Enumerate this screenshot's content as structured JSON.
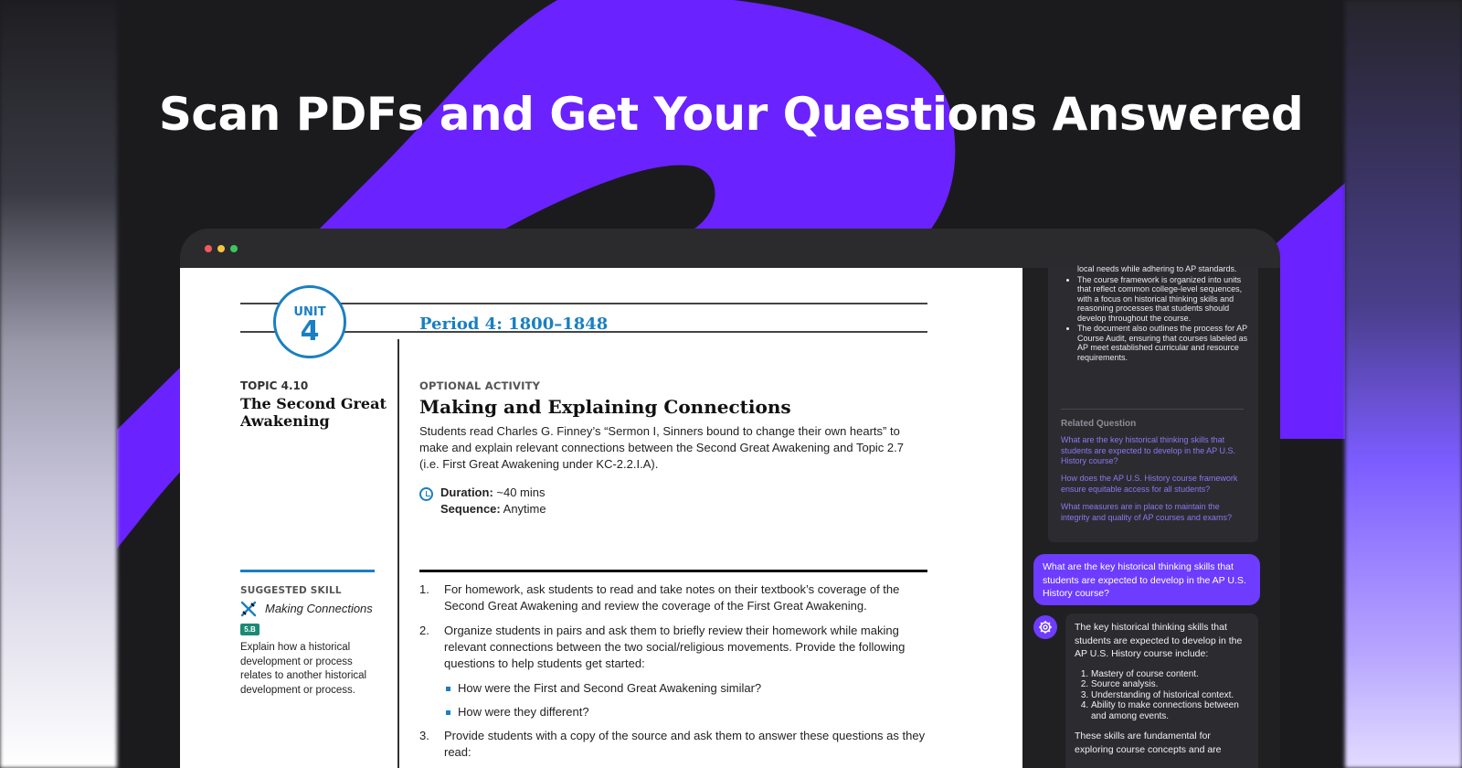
{
  "hero": {
    "title": "Scan PDFs and Get Your Questions Answered"
  },
  "colors": {
    "accent": "#6d2dff",
    "background": "#1b1b1e",
    "doc_blue": "#1a7fc1"
  },
  "window": {
    "controls": [
      "close",
      "minimize",
      "maximize"
    ]
  },
  "document": {
    "unit_label": "UNIT",
    "unit_number": "4",
    "period": "Period 4: 1800–1848",
    "topic_number": "TOPIC 4.10",
    "topic_title": "The Second Great Awakening",
    "optional_label": "OPTIONAL ACTIVITY",
    "activity_title": "Making and Explaining Connections",
    "activity_description": "Students read Charles G. Finney’s “Sermon I, Sinners bound to change their own hearts” to make and explain relevant connections between the Second Great Awakening and Topic 2.7 (i.e. First Great Awakening under KC-2.2.I.A).",
    "duration_label": "Duration:",
    "duration_value": " ~40 mins",
    "sequence_label": "Sequence:",
    "sequence_value": " Anytime",
    "suggested_skill_label": "SUGGESTED SKILL",
    "skill_name": "Making Connections",
    "skill_code": "5.B",
    "skill_description": "Explain how a historical development or process relates to another historical development or process.",
    "steps": [
      {
        "num": "1.",
        "text": "For homework, ask students to read and take notes on their textbook’s coverage of the Second Great Awakening and review the coverage of the First Great Awakening."
      },
      {
        "num": "2.",
        "text": "Organize students in pairs and ask them to briefly review their homework while making relevant connections between the two social/religious movements. Provide the following questions to help students get started:"
      },
      {
        "num": "3.",
        "text": "Provide students with a copy of the source and ask them to answer these questions as they read:"
      }
    ],
    "bullets": [
      "How were the First and Second Great Awakening similar?",
      "How were they different?"
    ]
  },
  "chat": {
    "answer_bullets": [
      "local needs while adhering to AP standards.",
      "The course framework is organized into units that reflect common college-level sequences, with a focus on historical thinking skills and reasoning processes that students should develop throughout the course.",
      "The document also outlines the process for AP Course Audit, ensuring that courses labeled as AP meet established curricular and resource requirements."
    ],
    "related_heading": "Related Question",
    "related_questions": [
      "What are the key historical thinking skills that students are expected to develop in the AP U.S. History course?",
      "How does the AP U.S. History course framework ensure equitable access for all students?",
      "What measures are in place to maintain the integrity and quality of AP courses and exams?"
    ],
    "user_message": "What are the key historical thinking skills that students are expected to develop in the AP U.S. History course?",
    "bot_intro": "The key historical thinking skills that students are expected to develop in the AP U.S. History course include:",
    "bot_list": [
      "Mastery of course content.",
      "Source analysis.",
      "Understanding of historical context.",
      "Ability to make connections between and among events."
    ],
    "bot_outro": "These skills are fundamental for exploring course concepts and are"
  }
}
